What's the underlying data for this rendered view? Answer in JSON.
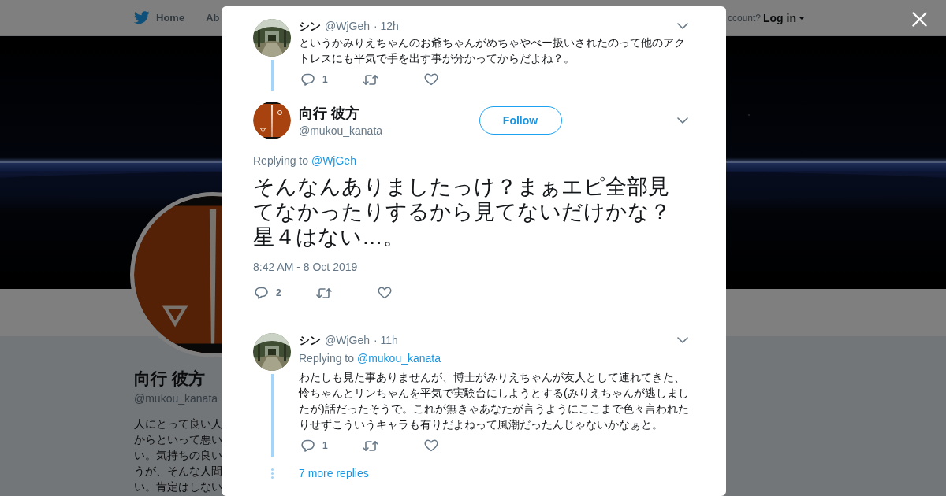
{
  "background": {
    "nav": {
      "items": [
        "Home",
        "Ab"
      ],
      "account_prompt": "ccount?",
      "login": "Log in"
    },
    "profile": {
      "name": "向行 彼方",
      "handle": "@mukou_kanata",
      "bio_lines": [
        "人にとって良い人",
        "からといって悪い",
        "い。気持ちの良い",
        "うが、そんな人間",
        "い。肯定はしない"
      ]
    }
  },
  "modal": {
    "parent_tweet": {
      "name": "シン",
      "handle": "@WjGeh",
      "time": "· 12h",
      "text": "というかみりえちゃんのお爺ちゃんがめちゃやべー扱いされたのって他のアクトレスにも平気で手を出す事が分かってからだよね？。",
      "replies": "1"
    },
    "main_tweet": {
      "name": "向行 彼方",
      "handle": "@mukou_kanata",
      "follow": "Follow",
      "replying_label": "Replying to",
      "replying_to": "@WjGeh",
      "text": "そんなんありましたっけ？まぁエピ全部見てなかったりするから見てないだけかな？星４はない…。",
      "timestamp": "8:42 AM - 8 Oct 2019",
      "replies": "2"
    },
    "replies": [
      {
        "name": "シン",
        "handle": "@WjGeh",
        "time": "· 11h",
        "replying_label": "Replying to",
        "replying_to": "@mukou_kanata",
        "text": "わたしも見た事ありませんが、博士がみりえちゃんが友人として連れてきた、怜ちゃんとリンちゃんを平気で実験台にしようとする(みりえちゃんが逃しましたが)話だったそうで。これが無きゃあなたが言うようにここまで色々言われたりせずこういうキャラも有りだよねって風潮だったんじゃないかなぁと。",
        "replies": "1"
      }
    ],
    "more_replies": "7 more replies"
  }
}
